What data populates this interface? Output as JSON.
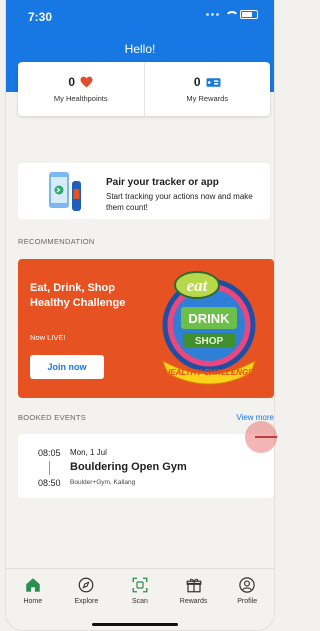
{
  "status_bar": {
    "time": "7:30"
  },
  "header": {
    "greeting": "Hello!"
  },
  "stats": {
    "healthpoints": {
      "value": "0",
      "label": "My Healthpoints",
      "icon": "heart-icon",
      "color": "#e04e2b"
    },
    "rewards": {
      "value": "0",
      "label": "My Rewards",
      "icon": "ticket-icon",
      "color": "#1778e3"
    }
  },
  "pair_tracker": {
    "title": "Pair your tracker or app",
    "description": "Start tracking your actions now and make them count!"
  },
  "recommendation": {
    "section_label": "RECOMMENDATION",
    "title": "Eat, Drink, Shop Healthy Challenge",
    "subtitle": "Now LIVE!",
    "cta": "Join now",
    "logo": {
      "word_1": "eat",
      "word_2": "DRINK",
      "word_3": "SHOP",
      "banner": "HEALTHY CHALLENGE"
    }
  },
  "booked_events": {
    "section_label": "BOOKED EVENTS",
    "view_more": "View more",
    "event": {
      "start_time": "08:05",
      "date": "Mon, 1 Jul",
      "title": "Bouldering Open Gym",
      "end_time": "08:50",
      "location": "Boulder+Gym, Kallang"
    }
  },
  "bottom_nav": [
    {
      "label": "Home",
      "icon": "home-icon",
      "active": true
    },
    {
      "label": "Explore",
      "icon": "compass-icon"
    },
    {
      "label": "Scan",
      "icon": "scan-icon"
    },
    {
      "label": "Rewards",
      "icon": "gift-icon"
    },
    {
      "label": "Profile",
      "icon": "profile-icon"
    }
  ],
  "colors": {
    "primary": "#1778e3",
    "accent_orange": "#e65221",
    "home_active": "#2a8f4f"
  }
}
